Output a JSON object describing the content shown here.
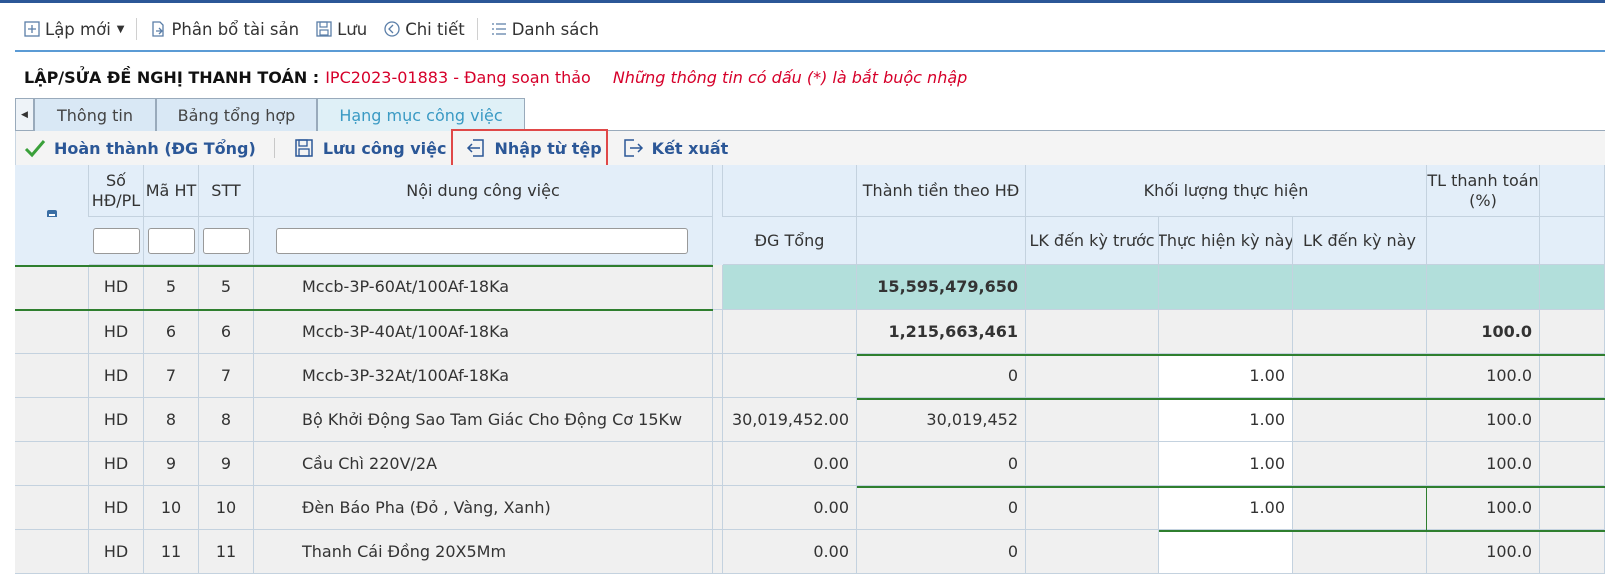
{
  "toolbar": {
    "new_label": "Lập mới",
    "allocate_label": "Phân bổ tài sản",
    "save_label": "Lưu",
    "detail_label": "Chi tiết",
    "list_label": "Danh sách"
  },
  "title": {
    "label": "LẬP/SỬA ĐỀ NGHỊ THANH TOÁN :",
    "code": "IPC2023-01883 - Đang soạn thảo",
    "note": "Những thông tin có dấu (*) là bắt buộc nhập"
  },
  "tabs": [
    {
      "label": "Thông tin",
      "active": false
    },
    {
      "label": "Bảng tổng hợp",
      "active": false
    },
    {
      "label": "Hạng mục công việc",
      "active": true
    }
  ],
  "subtoolbar": {
    "complete_label": "Hoàn thành (ĐG Tổng)",
    "save_work_label": "Lưu công việc",
    "import_label": "Nhập từ tệp",
    "export_label": "Kết xuất"
  },
  "grid": {
    "headers": {
      "contract": "Số HĐ/PL",
      "code": "Mã HT",
      "stt": "STT",
      "content": "Nội dung công việc",
      "amount": "Thành tiền theo HĐ",
      "volume": "Khối lượng thực hiện",
      "pay_rate": "TL thanh toán (%)",
      "unit_price": "ĐG Tổng",
      "prev": "LK đến kỳ trước",
      "current": "Thực hiện kỳ này",
      "cumulative": "LK đến kỳ này"
    },
    "rows": [
      {
        "contract": "HD",
        "code": "5",
        "stt": "5",
        "content": "Mccb-3P-60At/100Af-18Ka",
        "unit_price": "",
        "amount": "15,595,479,650",
        "prev": "",
        "current": "",
        "cumulative": "",
        "rate": ""
      },
      {
        "contract": "HD",
        "code": "6",
        "stt": "6",
        "content": "Mccb-3P-40At/100Af-18Ka",
        "unit_price": "",
        "amount": "1,215,663,461",
        "prev": "",
        "current": "",
        "cumulative": "",
        "rate": "100.0"
      },
      {
        "contract": "HD",
        "code": "7",
        "stt": "7",
        "content": "Mccb-3P-32At/100Af-18Ka",
        "unit_price": "",
        "amount": "0",
        "prev": "",
        "current": "1.00",
        "cumulative": "",
        "rate": "100.0"
      },
      {
        "contract": "HD",
        "code": "8",
        "stt": "8",
        "content": "Bộ Khởi Động Sao Tam Giác Cho Động Cơ 15Kw",
        "unit_price": "30,019,452.00",
        "amount": "30,019,452",
        "prev": "",
        "current": "1.00",
        "cumulative": "",
        "rate": "100.0"
      },
      {
        "contract": "HD",
        "code": "9",
        "stt": "9",
        "content": "Cầu Chì 220V/2A",
        "unit_price": "0.00",
        "amount": "0",
        "prev": "",
        "current": "1.00",
        "cumulative": "",
        "rate": "100.0"
      },
      {
        "contract": "HD",
        "code": "10",
        "stt": "10",
        "content": "Đèn Báo Pha (Đỏ , Vàng, Xanh)",
        "unit_price": "0.00",
        "amount": "0",
        "prev": "",
        "current": "1.00",
        "cumulative": "",
        "rate": "100.0"
      },
      {
        "contract": "HD",
        "code": "11",
        "stt": "11",
        "content": "Thanh Cái Đồng 20X5Mm",
        "unit_price": "0.00",
        "amount": "0",
        "prev": "",
        "current": "",
        "cumulative": "",
        "rate": "100.0"
      }
    ]
  },
  "colors": {
    "accent": "#2b5797",
    "required_note": "#d6002a",
    "header_bg": "#e3eef9",
    "selected_row": "#b2dfdb",
    "highlight_box": "#e04848"
  }
}
